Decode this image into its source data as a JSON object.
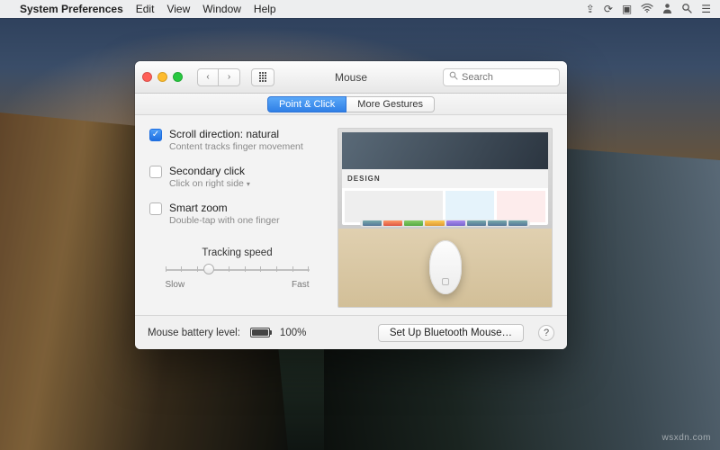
{
  "menubar": {
    "app_name": "System Preferences",
    "items": [
      "Edit",
      "View",
      "Window",
      "Help"
    ]
  },
  "window": {
    "title": "Mouse",
    "search_placeholder": "Search"
  },
  "tabs": {
    "point_click": "Point & Click",
    "more_gestures": "More Gestures",
    "active": "point_click"
  },
  "options": {
    "scroll": {
      "label": "Scroll direction: natural",
      "sub": "Content tracks finger movement",
      "checked": true
    },
    "secondary": {
      "label": "Secondary click",
      "sub": "Click on right side",
      "checked": false
    },
    "smart_zoom": {
      "label": "Smart zoom",
      "sub": "Double-tap with one finger",
      "checked": false
    }
  },
  "tracking": {
    "label": "Tracking speed",
    "slow": "Slow",
    "fast": "Fast"
  },
  "preview": {
    "site_heading": "DESIGN"
  },
  "footer": {
    "battery_label": "Mouse battery level:",
    "battery_value": "100%",
    "setup_button": "Set Up Bluetooth Mouse…"
  },
  "watermark": "wsxdn.com"
}
